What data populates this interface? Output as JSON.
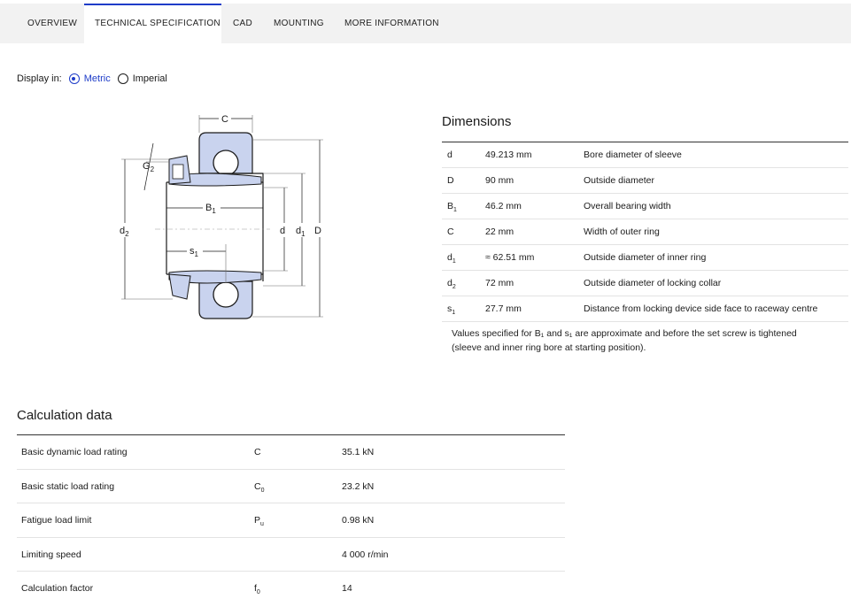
{
  "tabs": [
    {
      "label": "OVERVIEW"
    },
    {
      "label": "TECHNICAL SPECIFICATION"
    },
    {
      "label": "CAD"
    },
    {
      "label": "MOUNTING"
    },
    {
      "label": "MORE INFORMATION"
    }
  ],
  "display": {
    "label": "Display in:",
    "options": [
      {
        "label": "Metric",
        "checked": true
      },
      {
        "label": "Imperial",
        "checked": false
      }
    ]
  },
  "drawing": {
    "labels": {
      "C": "C",
      "G2": "G",
      "G2_sub": "2",
      "B1": "B",
      "B1_sub": "1",
      "d2": "d",
      "d2_sub": "2",
      "s1": "s",
      "s1_sub": "1",
      "d": "d",
      "d1": "d",
      "d1_sub": "1",
      "D": "D"
    },
    "colors": {
      "fill": "#c9d3ee",
      "line": "#1a1a1a",
      "guide": "#6f6f6f"
    }
  },
  "dimensions": {
    "title": "Dimensions",
    "rows": [
      {
        "sym": "d",
        "sub": "",
        "value": "49.213 mm",
        "desc": "Bore diameter of sleeve"
      },
      {
        "sym": "D",
        "sub": "",
        "value": "90 mm",
        "desc": "Outside diameter"
      },
      {
        "sym": "B",
        "sub": "1",
        "value": "46.2 mm",
        "desc": "Overall bearing width"
      },
      {
        "sym": "C",
        "sub": "",
        "value": "22 mm",
        "desc": "Width of outer ring"
      },
      {
        "sym": "d",
        "sub": "1",
        "value": "≈ 62.51 mm",
        "desc": "Outside diameter of inner ring"
      },
      {
        "sym": "d",
        "sub": "2",
        "value": "72 mm",
        "desc": "Outside diameter of locking collar"
      },
      {
        "sym": "s",
        "sub": "1",
        "value": "27.7 mm",
        "desc": "Distance from locking device side face to raceway centre"
      }
    ],
    "note_line1": "Values specified for B₁ and s₁ are approximate and before the set screw is tightened",
    "note_line2": "(sleeve and inner ring bore at starting position)."
  },
  "calculation": {
    "title": "Calculation data",
    "rows": [
      {
        "name": "Basic dynamic load rating",
        "sym": "C",
        "sub": "",
        "value": "35.1 kN"
      },
      {
        "name": "Basic static load rating",
        "sym": "C",
        "sub": "0",
        "value": "23.2 kN"
      },
      {
        "name": "Fatigue load limit",
        "sym": "P",
        "sub": "u",
        "value": "0.98 kN"
      },
      {
        "name": "Limiting speed",
        "sym": "",
        "sub": "",
        "value": "4 000 r/min"
      },
      {
        "name": "Calculation factor",
        "sym": "f",
        "sub": "0",
        "value": "14"
      }
    ]
  }
}
